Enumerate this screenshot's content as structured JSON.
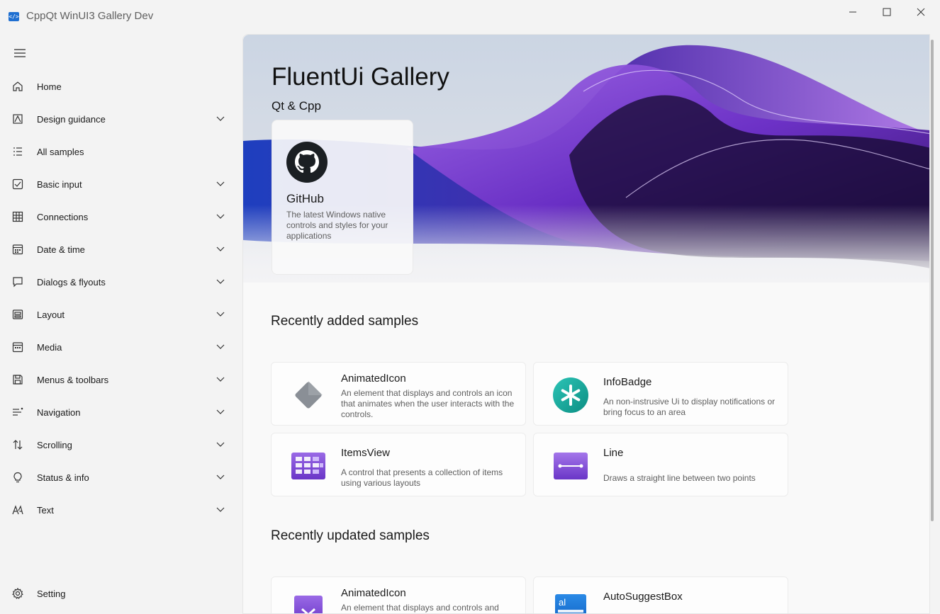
{
  "window": {
    "title": "CppQt WinUI3 Gallery Dev",
    "controls": {
      "minimize": "—",
      "maximize": "☐",
      "close": "✕"
    }
  },
  "sidebar": {
    "menu_icon": "hamburger-icon",
    "items": [
      {
        "label": "Home",
        "icon": "home-icon",
        "expandable": false
      },
      {
        "label": "Design guidance",
        "icon": "design-guidance-icon",
        "expandable": true
      },
      {
        "label": "All samples",
        "icon": "list-icon",
        "expandable": false
      },
      {
        "label": "Basic input",
        "icon": "checkbox-icon",
        "expandable": true
      },
      {
        "label": "Connections",
        "icon": "grid-icon",
        "expandable": true
      },
      {
        "label": "Date & time",
        "icon": "calendar-icon",
        "expandable": true
      },
      {
        "label": "Dialogs & flyouts",
        "icon": "chat-icon",
        "expandable": true
      },
      {
        "label": "Layout",
        "icon": "layout-icon",
        "expandable": true
      },
      {
        "label": "Media",
        "icon": "media-icon",
        "expandable": true
      },
      {
        "label": "Menus & toolbars",
        "icon": "save-icon",
        "expandable": true
      },
      {
        "label": "Navigation",
        "icon": "navigation-icon",
        "expandable": true
      },
      {
        "label": "Scrolling",
        "icon": "scrolling-icon",
        "expandable": true
      },
      {
        "label": "Status & info",
        "icon": "lightbulb-icon",
        "expandable": true
      },
      {
        "label": "Text",
        "icon": "text-icon",
        "expandable": true
      }
    ],
    "footer": {
      "label": "Setting",
      "icon": "gear-icon"
    }
  },
  "hero": {
    "title": "FluentUi Gallery",
    "subtitle": "Qt & Cpp",
    "card": {
      "title": "GitHub",
      "description": "The latest Windows native controls and styles for your applications",
      "icon": "github-icon"
    }
  },
  "recently_added": {
    "title": "Recently added samples",
    "items": [
      {
        "title": "AnimatedIcon",
        "description": "An element that displays and controls an icon that animates when the user interacts with the controls.",
        "icon": "animated-icon-diamond"
      },
      {
        "title": "InfoBadge",
        "description": "An non-instrusive Ui to display notifications or bring focus to an area",
        "icon": "infobadge-icon"
      },
      {
        "title": "ItemsView",
        "description": "A control that presents a collection of items using various layouts",
        "icon": "itemsview-icon"
      },
      {
        "title": "Line",
        "description": "Draws a straight line between two points",
        "icon": "line-icon"
      }
    ]
  },
  "recently_updated": {
    "title": "Recently updated samples",
    "items": [
      {
        "title": "AnimatedIcon",
        "description": "An element that displays and controls and",
        "icon": "animated-icon-check"
      },
      {
        "title": "AutoSuggestBox",
        "description": "",
        "icon": "autosuggestbox-icon"
      }
    ]
  },
  "colors": {
    "accent": "#1f6fd1",
    "purple": "#7b4fd6",
    "teal": "#12a89a"
  }
}
